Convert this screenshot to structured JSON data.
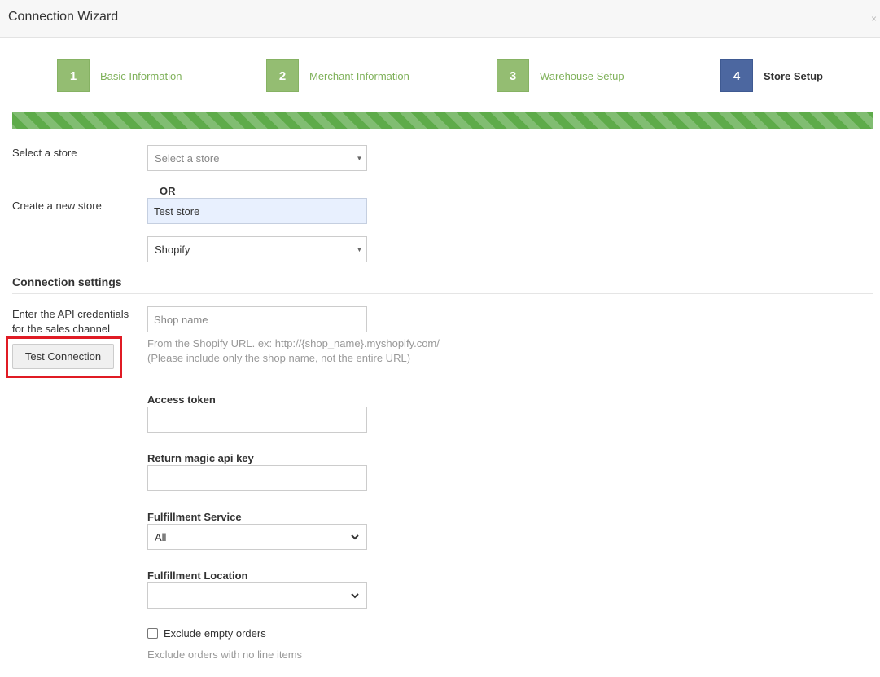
{
  "header": {
    "title": "Connection Wizard",
    "close": "×"
  },
  "steps": [
    {
      "num": "1",
      "label": "Basic Information"
    },
    {
      "num": "2",
      "label": "Merchant Information"
    },
    {
      "num": "3",
      "label": "Warehouse Setup"
    },
    {
      "num": "4",
      "label": "Store Setup"
    }
  ],
  "progress": {
    "value_percent": 100
  },
  "store": {
    "select_label": "Select a store",
    "select_placeholder": "Select a store",
    "or_text": "OR",
    "create_label": "Create a new store",
    "new_store_value": "Test store",
    "channel_value": "Shopify"
  },
  "connection": {
    "section_title": "Connection settings",
    "api_help": "Enter the API credentials for the sales channel",
    "test_button": "Test Connection",
    "shop_name_placeholder": "Shop name",
    "shop_help_1": "From the Shopify URL. ex: http://{shop_name}.myshopify.com/",
    "shop_help_2": "(Please include only the shop name, not the entire URL)",
    "access_token_label": "Access token",
    "access_token_value": "",
    "return_key_label": "Return magic api key",
    "return_key_value": "",
    "fulfillment_service_label": "Fulfillment Service",
    "fulfillment_service_value": "All",
    "fulfillment_location_label": "Fulfillment Location",
    "fulfillment_location_value": "",
    "exclude_empty_label": "Exclude empty orders",
    "exclude_empty_checked": false,
    "exclude_empty_help": "Exclude orders with no line items"
  },
  "colors": {
    "step_done": "#94bd72",
    "step_active": "#4c67a0",
    "step_done_text": "#7fb15a",
    "progress_bar": "#5eab4a",
    "highlight": "#e01b24"
  }
}
